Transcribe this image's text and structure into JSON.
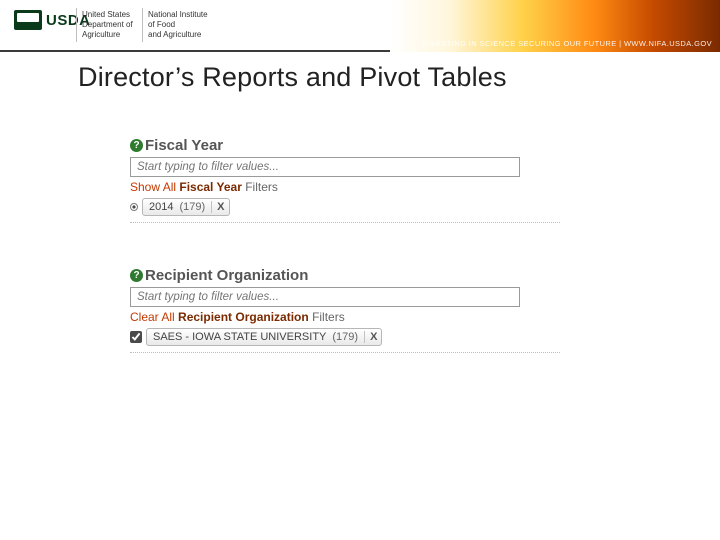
{
  "header": {
    "org_acronym": "USDA",
    "dept_line1": "United States",
    "dept_line2": "Department of",
    "dept_line3": "Agriculture",
    "inst_line1": "National Institute",
    "inst_line2": "of Food",
    "inst_line3": "and Agriculture",
    "tagline": "INVESTING IN SCIENCE   SECURING OUR FUTURE | WWW.NIFA.USDA.GOV"
  },
  "title": "Director’s Reports and Pivot Tables",
  "fiscal_year": {
    "heading": "Fiscal Year",
    "input_placeholder": "Start typing to filter values...",
    "toggle_action": "Show All",
    "toggle_label": "Fiscal Year",
    "toggle_suffix": "Filters",
    "chip_value": "2014",
    "chip_count": "(179)",
    "chip_close": "X"
  },
  "recipient_org": {
    "heading": "Recipient Organization",
    "input_placeholder": "Start typing to filter values...",
    "toggle_action": "Clear All",
    "toggle_label": "Recipient Organization",
    "toggle_suffix": "Filters",
    "chip_value": "SAES - IOWA STATE UNIVERSITY",
    "chip_count": "(179)",
    "chip_close": "X"
  }
}
